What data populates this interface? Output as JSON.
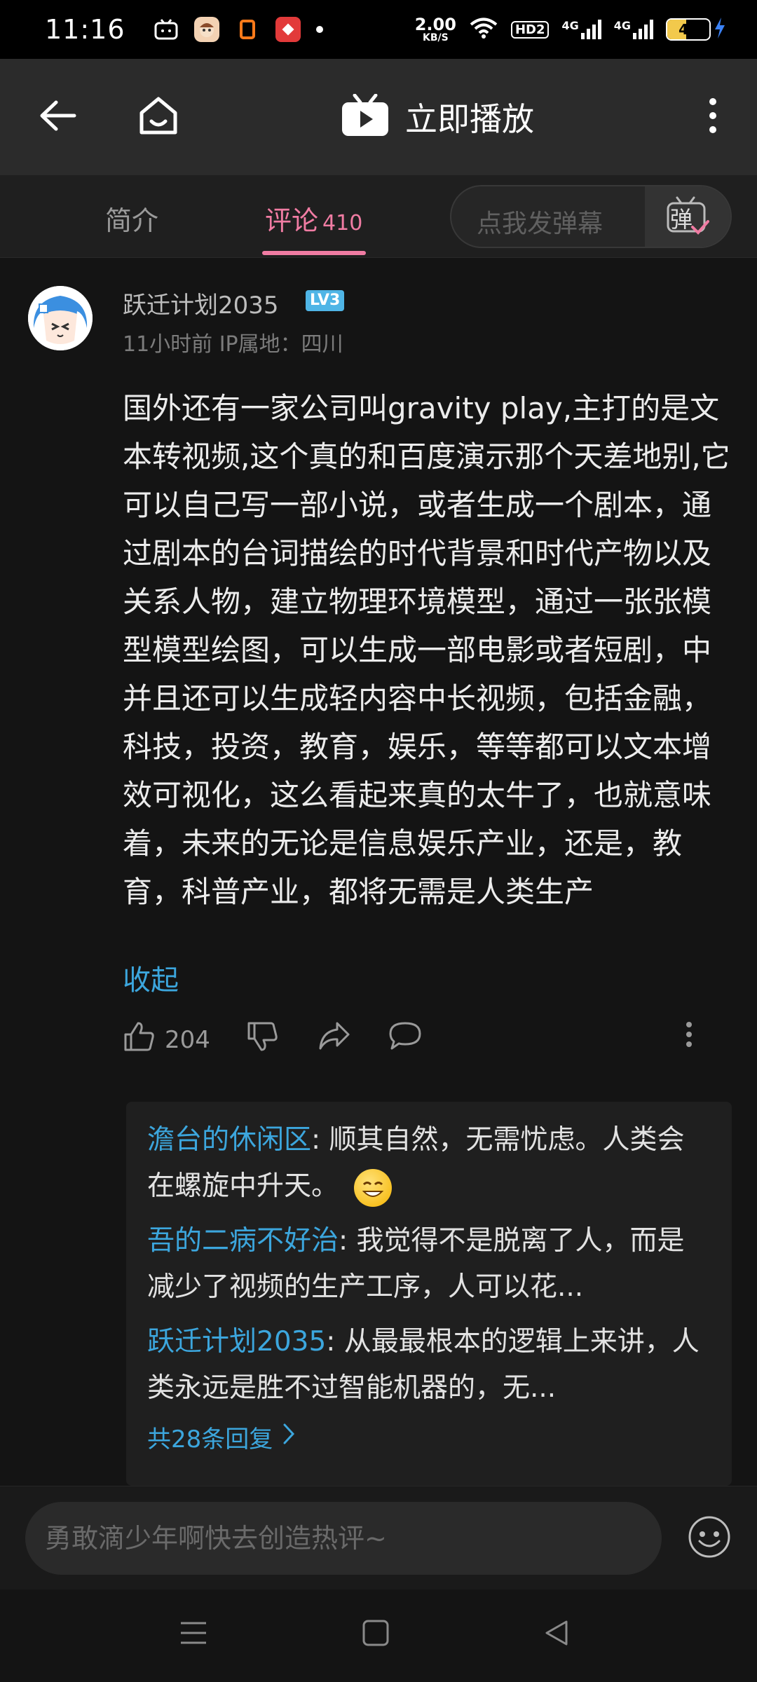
{
  "status_bar": {
    "time": "11:16",
    "net_speed_value": "2.00",
    "net_speed_unit": "KB/S",
    "hd_label": "HD2",
    "signal_1_label": "4G",
    "signal_2_label": "4G",
    "battery_level": "45"
  },
  "title_bar": {
    "title": "立即播放"
  },
  "tabs": {
    "intro_label": "简介",
    "comments_label": "评论",
    "comments_count": "410",
    "danmaku_placeholder": "点我发弹幕",
    "danmaku_button_label": "弹"
  },
  "comment": {
    "username": "跃迁计划2035",
    "level": "LV3",
    "meta": "11小时前  IP属地：四川",
    "text": "国外还有一家公司叫gravity play,主打的是文本转视频,这个真的和百度演示那个天差地别,它可以自己写一部小说，或者生成一个剧本，通过剧本的台词描绘的时代背景和时代产物以及关系人物，建立物理环境模型，通过一张张模型模型绘图，可以生成一部电影或者短剧，中并且还可以生成轻内容中长视频，包括金融，科技，投资，教育，娱乐，等等都可以文本增效可视化，这么看起来真的太牛了，也就意味着，未来的无论是信息娱乐产业，还是，教育，科普产业，都将无需是人类生产",
    "collapse_label": "收起",
    "like_count": "204"
  },
  "replies": [
    {
      "user": "澹台的休闲区",
      "text": ": 顺其自然，无需忧虑。人类会在螺旋中升天。"
    },
    {
      "user": "吾的二病不好治",
      "text": ": 我觉得不是脱离了人，而是减少了视频的生产工序，人可以花..."
    },
    {
      "user": "跃迁计划2035",
      "text": ": 从最最根本的逻辑上来讲，人类永远是胜不过智能机器的，无..."
    }
  ],
  "more_replies_label": "共28条回复",
  "input": {
    "placeholder": "勇敢滴少年啊快去创造热评~"
  },
  "colors": {
    "accent_pink": "#f07ca3",
    "link_blue": "#3ca6dd",
    "background": "#141414"
  }
}
